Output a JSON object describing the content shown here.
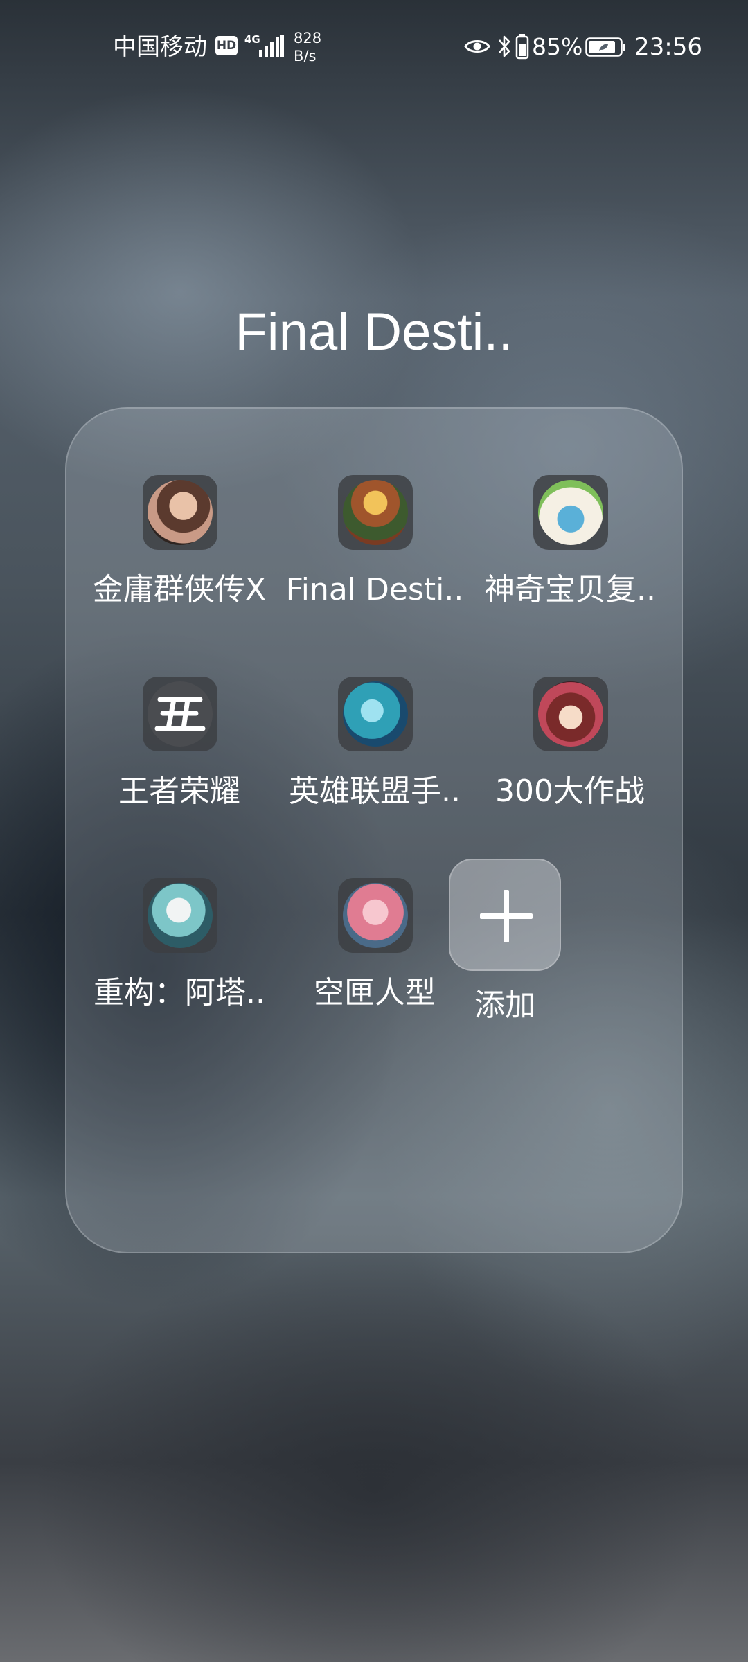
{
  "status_bar": {
    "carrier": "中国移动",
    "hd_badge": "HD",
    "network_type": "4G",
    "net_speed_value": "828",
    "net_speed_unit": "B/s",
    "battery_percent": "85%",
    "time": "23:56",
    "icons": [
      "hd-icon",
      "signal-icon",
      "eye-icon",
      "bluetooth-icon",
      "battery-icon"
    ]
  },
  "folder": {
    "title": "Final Desti..",
    "apps": [
      {
        "label": "金庸群侠传X",
        "icon": "jinyong-app-icon"
      },
      {
        "label": "Final Desti..",
        "icon": "final-destiny-app-icon"
      },
      {
        "label": "神奇宝贝复..",
        "icon": "pokemon-app-icon"
      },
      {
        "label": "王者荣耀",
        "icon": "honor-of-kings-app-icon"
      },
      {
        "label": "英雄联盟手..",
        "icon": "league-of-legends-app-icon"
      },
      {
        "label": "300大作战",
        "icon": "300-battle-app-icon"
      },
      {
        "label": "重构：阿塔..",
        "icon": "atlantis-app-icon"
      },
      {
        "label": "空匣人型",
        "icon": "empty-box-doll-app-icon"
      }
    ],
    "add_label": "添加",
    "add_icon": "plus-icon"
  }
}
